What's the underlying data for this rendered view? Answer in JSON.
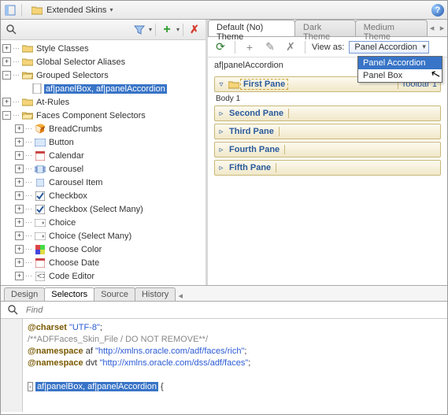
{
  "topbar": {
    "project_label": "Extended Skins"
  },
  "left_toolbar": {},
  "tree": {
    "n0": "Style Classes",
    "n1": "Global Selector Aliases",
    "n2": "Grouped Selectors",
    "n2_0": "af|panelBox, af|panelAccordion",
    "n3": "At-Rules",
    "n4": "Faces Component Selectors",
    "n4_0": "BreadCrumbs",
    "n4_1": "Button",
    "n4_2": "Calendar",
    "n4_3": "Carousel",
    "n4_4": "Carousel Item",
    "n4_5": "Checkbox",
    "n4_6": "Checkbox (Select Many)",
    "n4_7": "Choice",
    "n4_8": "Choice (Select Many)",
    "n4_9": "Choose Color",
    "n4_10": "Choose Date",
    "n4_11": "Code Editor"
  },
  "themetabs": {
    "t0": "Default (No) Theme",
    "t1": "Dark Theme",
    "t2": "Medium Theme"
  },
  "rtoolbar": {
    "viewas": "View as:",
    "combo": "Panel Accordion"
  },
  "dd": {
    "o0": "Panel Accordion",
    "o1": "Panel Box"
  },
  "rpath": "af|panelAccordion",
  "panes": {
    "p0": "First Pane",
    "tb0": "Toolbar 1",
    "body": "Body 1",
    "p1": "Second Pane",
    "p2": "Third Pane",
    "p3": "Fourth Pane",
    "p4": "Fifth Pane"
  },
  "btabs": {
    "t0": "Design",
    "t1": "Selectors",
    "t2": "Source",
    "t3": "History"
  },
  "find": {
    "ph": "Find"
  },
  "code": {
    "l1a": "@charset",
    "l1b": "\"UTF-8\"",
    "l2": "/**ADFFaces_Skin_File / DO NOT REMOVE**/",
    "l3a": "@namespace",
    "l3b": "af",
    "l3c": "\"http://xmlns.oracle.com/adf/faces/rich\"",
    "l4a": "@namespace",
    "l4b": "dvt",
    "l4c": "\"http://xmlns.oracle.com/dss/adf/faces\"",
    "l6": "af|panelBox, af|panelAccordion"
  }
}
